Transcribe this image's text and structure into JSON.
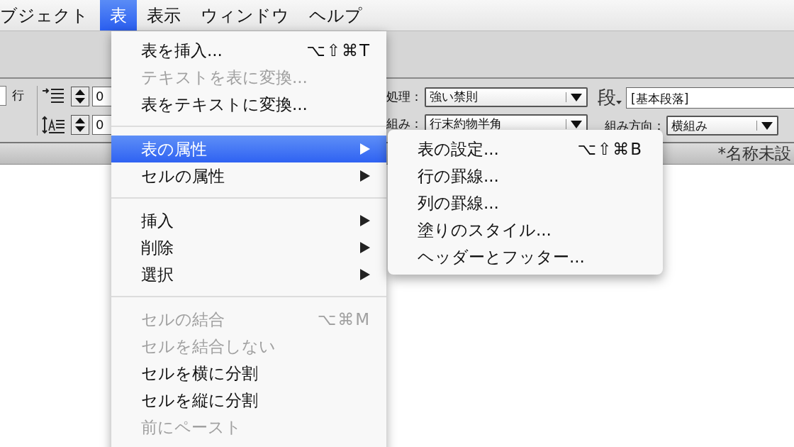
{
  "menubar": [
    {
      "label": "ブジェクト",
      "selected": false
    },
    {
      "label": "表",
      "selected": true
    },
    {
      "label": "表示",
      "selected": false
    },
    {
      "label": "ウィンドウ",
      "selected": false
    },
    {
      "label": "ヘルプ",
      "selected": false
    }
  ],
  "toolbar": {
    "rows_label": "行",
    "spacing_fields": [
      {
        "value": "0"
      },
      {
        "value": "0"
      }
    ],
    "kinsoku_label": "処理：",
    "kinsoku_value": "強い禁則",
    "mojikumi_label": "組み：",
    "mojikumi_value": "行末約物半角",
    "paragraph_icon_label": "段",
    "paragraph_style": "[基本段落]",
    "direction_label": "組み方向：",
    "direction_value": "横組み"
  },
  "document_tab": "*名称未設",
  "menu": {
    "items": [
      {
        "kind": "item",
        "label": "表を挿入...",
        "shortcut": "⌥⇧⌘T",
        "disabled": false,
        "submenu": false,
        "selected": false
      },
      {
        "kind": "item",
        "label": "テキストを表に変換...",
        "disabled": true,
        "submenu": false,
        "selected": false
      },
      {
        "kind": "item",
        "label": "表をテキストに変換...",
        "disabled": false,
        "submenu": false,
        "selected": false
      },
      {
        "kind": "separator"
      },
      {
        "kind": "item",
        "label": "表の属性",
        "disabled": false,
        "submenu": true,
        "selected": true
      },
      {
        "kind": "item",
        "label": "セルの属性",
        "disabled": false,
        "submenu": true,
        "selected": false
      },
      {
        "kind": "separator"
      },
      {
        "kind": "item",
        "label": "挿入",
        "disabled": false,
        "submenu": true,
        "selected": false
      },
      {
        "kind": "item",
        "label": "削除",
        "disabled": false,
        "submenu": true,
        "selected": false
      },
      {
        "kind": "item",
        "label": "選択",
        "disabled": false,
        "submenu": true,
        "selected": false
      },
      {
        "kind": "separator"
      },
      {
        "kind": "item",
        "label": "セルの結合",
        "shortcut": "⌥⌘M",
        "disabled": true,
        "submenu": false,
        "selected": false
      },
      {
        "kind": "item",
        "label": "セルを結合しない",
        "disabled": true,
        "submenu": false,
        "selected": false
      },
      {
        "kind": "item",
        "label": "セルを横に分割",
        "disabled": false,
        "submenu": false,
        "selected": false
      },
      {
        "kind": "item",
        "label": "セルを縦に分割",
        "disabled": false,
        "submenu": false,
        "selected": false
      },
      {
        "kind": "item",
        "label": "前にペースト",
        "disabled": true,
        "submenu": false,
        "selected": false
      }
    ]
  },
  "submenu": {
    "items": [
      {
        "label": "表の設定...",
        "shortcut": "⌥⇧⌘B"
      },
      {
        "label": "行の罫線..."
      },
      {
        "label": "列の罫線..."
      },
      {
        "label": "塗りのスタイル..."
      },
      {
        "label": "ヘッダーとフッター..."
      }
    ]
  }
}
